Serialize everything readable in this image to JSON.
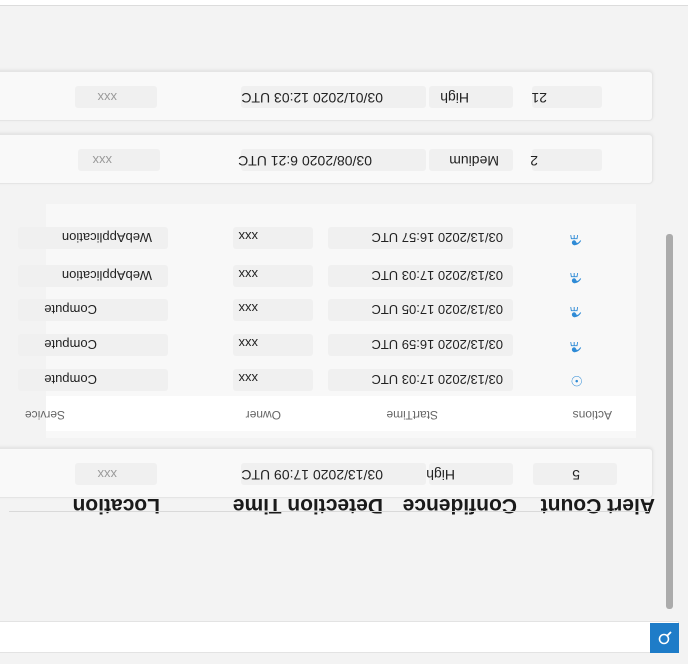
{
  "table": {
    "headers": {
      "location": "Location",
      "detection_time": "Detection Time",
      "confidence": "Confidence",
      "alert_count": "Alert Count"
    },
    "rows": [
      {
        "location": "xxx",
        "detection_time": "03/13/2020 17:09 UTC",
        "confidence": "High",
        "alert_count": "5"
      },
      {
        "location": "xxx",
        "detection_time": "03/08/2020 6:21 UTC",
        "confidence": "Medium",
        "alert_count": "2"
      },
      {
        "location": "xxx",
        "detection_time": "03/01/2020 12:03 UTC",
        "confidence": "High",
        "alert_count": "21"
      }
    ]
  },
  "subtable": {
    "headers": {
      "service": "Service",
      "owner": "Owner",
      "start_time": "StartTime",
      "actions": "Actions"
    },
    "rows": [
      {
        "service": "Compute",
        "owner": "xxx",
        "start_time": "03/13/2020 17:03 UTC",
        "action_icon": "eye-icon"
      },
      {
        "service": "Compute",
        "owner": "xxx",
        "start_time": "03/13/2020 16:59 UTC",
        "action_icon": "flask-icon"
      },
      {
        "service": "Compute",
        "owner": "xxx",
        "start_time": "03/13/2020 17:05 UTC",
        "action_icon": "flask-icon"
      },
      {
        "service": "WebApplication",
        "owner": "xxx",
        "start_time": "03/13/2020 17:03 UTC",
        "action_icon": "flask-icon"
      },
      {
        "service": "WebApplication",
        "owner": "xxx",
        "start_time": "03/13/2020 16:57 UTC",
        "action_icon": "flask-icon"
      }
    ]
  },
  "colors": {
    "accent": "#1e7cc8",
    "icon": "#2f8bd6"
  }
}
